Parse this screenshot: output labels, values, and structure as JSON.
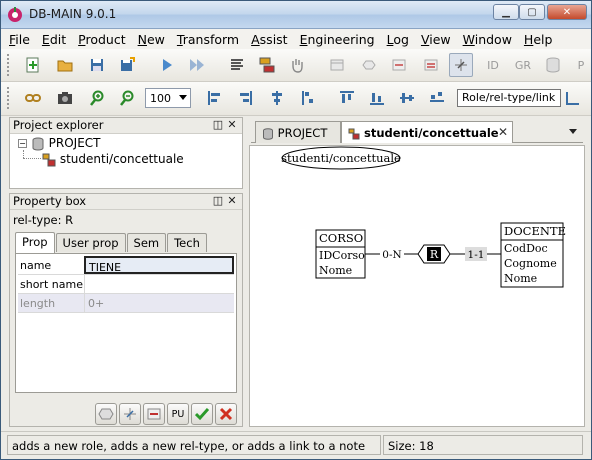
{
  "window": {
    "title": "DB-MAIN 9.0.1"
  },
  "menu": [
    {
      "mnemonic": "F",
      "rest": "ile"
    },
    {
      "mnemonic": "E",
      "rest": "dit"
    },
    {
      "mnemonic": "P",
      "rest": "roduct"
    },
    {
      "mnemonic": "N",
      "rest": "ew"
    },
    {
      "mnemonic": "T",
      "rest": "ransform"
    },
    {
      "mnemonic": "A",
      "rest": "ssist"
    },
    {
      "mnemonic": "E",
      "rest": "ngineering"
    },
    {
      "mnemonic": "L",
      "rest": "og"
    },
    {
      "mnemonic": "V",
      "rest": "iew"
    },
    {
      "mnemonic": "W",
      "rest": "indow"
    },
    {
      "mnemonic": "H",
      "rest": "elp"
    }
  ],
  "toolbar1": {
    "id_label": "ID",
    "gr_label": "GR",
    "p_label": "P"
  },
  "toolbar2": {
    "zoom": "100"
  },
  "tooltip": "Role/rel-type/link",
  "project_explorer": {
    "title": "Project explorer",
    "root": "PROJECT",
    "child": "studenti/concettuale"
  },
  "property_box": {
    "title": "Property box",
    "subject": "rel-type: R",
    "tabs": [
      "Prop",
      "User prop",
      "Sem",
      "Tech"
    ],
    "rows": [
      {
        "name": "name",
        "value": "TIENE"
      },
      {
        "name": "short name",
        "value": ""
      },
      {
        "name": "length",
        "value": "0+"
      }
    ],
    "pu_label": "PU"
  },
  "editor": {
    "tabs": [
      {
        "label": "PROJECT"
      },
      {
        "label": "studenti/concettuale"
      }
    ],
    "schema_label": "studenti/concettuale",
    "entities": [
      {
        "name": "CORSO",
        "attributes": [
          "IDCorso",
          "Nome"
        ]
      },
      {
        "name": "DOCENTE",
        "attributes": [
          "CodDoc",
          "Cognome",
          "Nome"
        ]
      }
    ],
    "reltype": "R",
    "roles": [
      "0-N",
      "1-1"
    ]
  },
  "status": {
    "message": "adds a new role, adds a new rel-type, or adds a link to a note",
    "size": "Size: 18"
  },
  "colors": {
    "accent": "#3a6ea5",
    "selection": "#c8d8ee",
    "close_red": "#c44a2c"
  }
}
